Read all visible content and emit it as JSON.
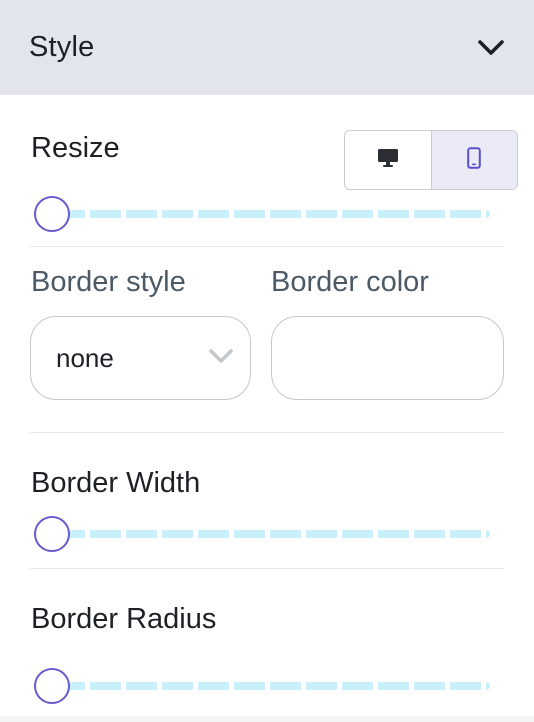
{
  "header": {
    "title": "Style",
    "collapse_icon": "chevron-down-icon"
  },
  "resize": {
    "label": "Resize",
    "devices": [
      {
        "name": "desktop",
        "icon": "desktop-icon",
        "selected": false
      },
      {
        "name": "mobile",
        "icon": "mobile-icon",
        "selected": true
      }
    ],
    "slider_value": 0
  },
  "border_style": {
    "label": "Border style",
    "value": "none",
    "icon": "chevron-down-icon"
  },
  "border_color": {
    "label": "Border color",
    "value": ""
  },
  "border_width": {
    "label": "Border Width",
    "slider_value": 0
  },
  "border_radius": {
    "label": "Border Radius",
    "slider_value": 0
  },
  "colors": {
    "header_bg": "#e2e6ec",
    "slider_track": "#c8f0fb",
    "slider_thumb_border": "#6a5acd",
    "active_toggle_bg": "#ebebf8"
  }
}
